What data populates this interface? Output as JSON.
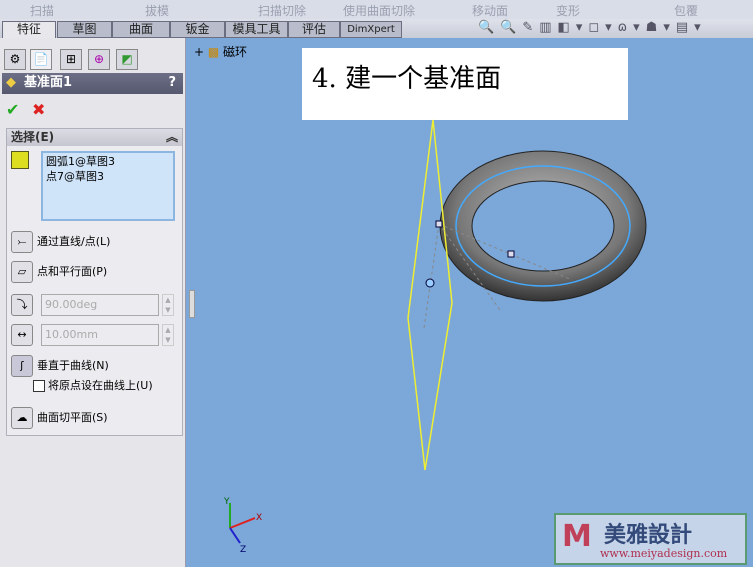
{
  "command_bar": [
    "扫描",
    "拔模",
    "扫描切除",
    "使用曲面切除",
    "移动面",
    "变形",
    "包覆"
  ],
  "tabs": [
    "特征",
    "草图",
    "曲面",
    "钣金",
    "模具工具",
    "评估",
    "DimXpert"
  ],
  "tree_root": "磁环",
  "panel": {
    "title": "基准面1",
    "help": "?",
    "section": "选择(E)",
    "selections": [
      "圆弧1@草图3",
      "点7@草图3"
    ],
    "options": {
      "through": "通过直线/点(L)",
      "parallel": "点和平行面(P)",
      "angle": "90.00deg",
      "distance": "10.00mm",
      "normal": "垂直于曲线(N)",
      "origin_on_curve": "将原点设在曲线上(U)",
      "tangent": "曲面切平面(S)"
    }
  },
  "annotation": "4. 建一个基准面",
  "logo": {
    "name": "美雅設計",
    "url": "www.meiyadesign.com"
  },
  "axes": {
    "x": "X",
    "y": "Y",
    "z": "Z"
  }
}
